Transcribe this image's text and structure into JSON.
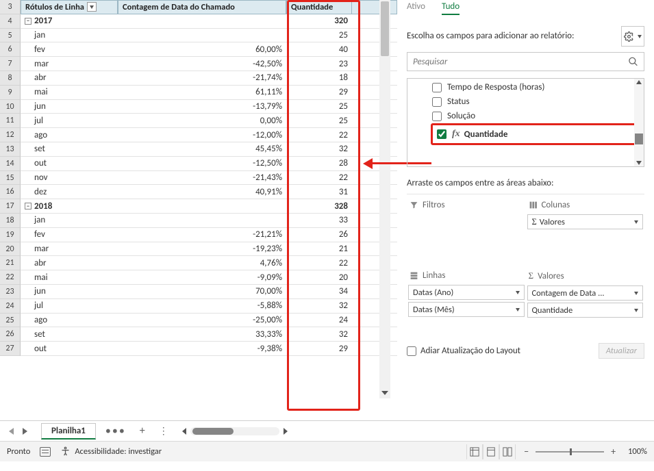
{
  "pivot_headers": {
    "rows_label": "Rótulos de Linha",
    "count_label": "Contagem de Data do Chamado",
    "qty_label": "Quantidade"
  },
  "pivot_rows": [
    {
      "rn": 3,
      "type": "header"
    },
    {
      "rn": 4,
      "type": "year",
      "label": "2017",
      "qty": "320"
    },
    {
      "rn": 5,
      "type": "month",
      "label": "jan",
      "pct": "",
      "qty": "25"
    },
    {
      "rn": 6,
      "type": "month",
      "label": "fev",
      "pct": "60,00%",
      "qty": "40"
    },
    {
      "rn": 7,
      "type": "month",
      "label": "mar",
      "pct": "-42,50%",
      "qty": "23"
    },
    {
      "rn": 8,
      "type": "month",
      "label": "abr",
      "pct": "-21,74%",
      "qty": "18"
    },
    {
      "rn": 9,
      "type": "month",
      "label": "mai",
      "pct": "61,11%",
      "qty": "29"
    },
    {
      "rn": 10,
      "type": "month",
      "label": "jun",
      "pct": "-13,79%",
      "qty": "25"
    },
    {
      "rn": 11,
      "type": "month",
      "label": "jul",
      "pct": "0,00%",
      "qty": "25"
    },
    {
      "rn": 12,
      "type": "month",
      "label": "ago",
      "pct": "-12,00%",
      "qty": "22"
    },
    {
      "rn": 13,
      "type": "month",
      "label": "set",
      "pct": "45,45%",
      "qty": "32"
    },
    {
      "rn": 14,
      "type": "month",
      "label": "out",
      "pct": "-12,50%",
      "qty": "28"
    },
    {
      "rn": 15,
      "type": "month",
      "label": "nov",
      "pct": "-21,43%",
      "qty": "22"
    },
    {
      "rn": 16,
      "type": "month",
      "label": "dez",
      "pct": "40,91%",
      "qty": "31"
    },
    {
      "rn": 17,
      "type": "year",
      "label": "2018",
      "qty": "328"
    },
    {
      "rn": 18,
      "type": "month",
      "label": "jan",
      "pct": "",
      "qty": "33"
    },
    {
      "rn": 19,
      "type": "month",
      "label": "fev",
      "pct": "-21,21%",
      "qty": "26"
    },
    {
      "rn": 20,
      "type": "month",
      "label": "mar",
      "pct": "-19,23%",
      "qty": "21"
    },
    {
      "rn": 21,
      "type": "month",
      "label": "abr",
      "pct": "4,76%",
      "qty": "22"
    },
    {
      "rn": 22,
      "type": "month",
      "label": "mai",
      "pct": "-9,09%",
      "qty": "20"
    },
    {
      "rn": 23,
      "type": "month",
      "label": "jun",
      "pct": "70,00%",
      "qty": "34"
    },
    {
      "rn": 24,
      "type": "month",
      "label": "jul",
      "pct": "-5,88%",
      "qty": "32"
    },
    {
      "rn": 25,
      "type": "month",
      "label": "ago",
      "pct": "-25,00%",
      "qty": "24"
    },
    {
      "rn": 26,
      "type": "month",
      "label": "set",
      "pct": "33,33%",
      "qty": "32"
    },
    {
      "rn": 27,
      "type": "month",
      "label": "out",
      "pct": "-9,38%",
      "qty": "29"
    }
  ],
  "field_pane": {
    "tab_active": "Ativo",
    "tab_all": "Tudo",
    "help_text": "Escolha os campos para adicionar ao relatório:",
    "search_placeholder": "Pesquisar",
    "fields": [
      {
        "label": "Tempo de Resposta (horas)",
        "checked": false,
        "fx": false
      },
      {
        "label": "Status",
        "checked": false,
        "fx": false
      },
      {
        "label": "Solução",
        "checked": false,
        "fx": false
      },
      {
        "label": "Quantidade",
        "checked": true,
        "fx": true
      }
    ],
    "drag_hint": "Arraste os campos entre as áreas abaixo:",
    "zones": {
      "filters": "Filtros",
      "columns": "Colunas",
      "rows": "Linhas",
      "values": "Valores"
    },
    "columns_items": [
      "Valores"
    ],
    "rows_items": [
      "Datas (Ano)",
      "Datas (Mês)"
    ],
    "values_items": [
      "Contagem de Data ...",
      "Quantidade"
    ],
    "defer_label": "Adiar Atualização do Layout",
    "update_btn": "Atualizar"
  },
  "sheet": {
    "tab_name": "Planilha1"
  },
  "status": {
    "ready": "Pronto",
    "accessibility": "Acessibilidade: investigar",
    "zoom": "100%"
  }
}
